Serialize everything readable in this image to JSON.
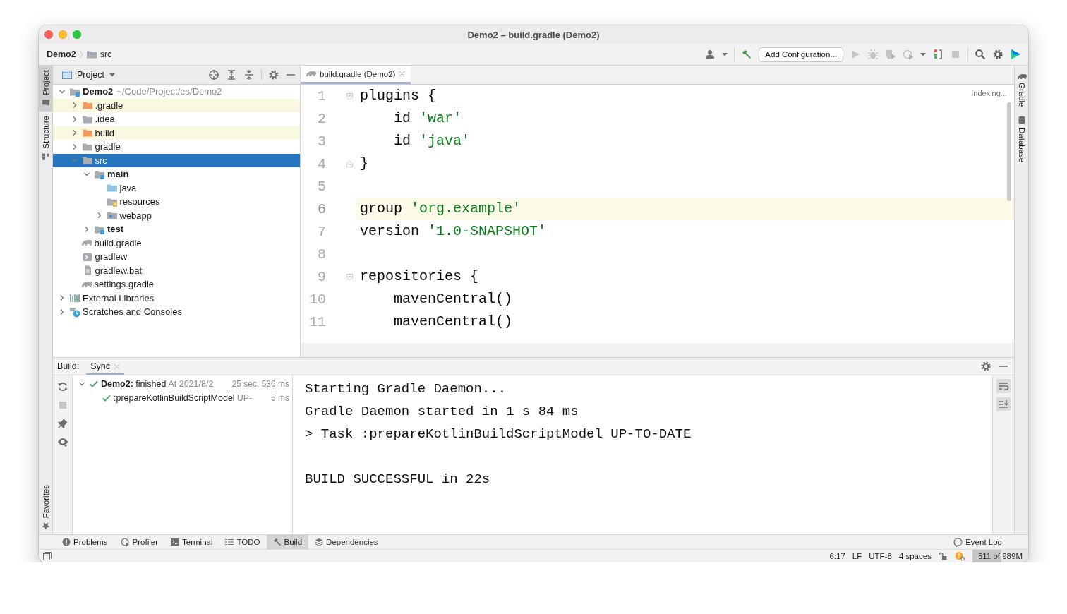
{
  "window": {
    "title": "Demo2 – build.gradle (Demo2)"
  },
  "breadcrumb": [
    {
      "label": "Demo2",
      "kind": "project"
    },
    {
      "label": "src",
      "kind": "folder"
    }
  ],
  "toolbar": {
    "run_config": "Add Configuration..."
  },
  "left_stripe_top": [
    {
      "label": "Project",
      "kind": "folder",
      "selected": true
    },
    {
      "label": "Structure",
      "kind": "structure",
      "selected": false
    }
  ],
  "left_stripe_bottom": [
    {
      "label": "Favorites",
      "kind": "star",
      "selected": false
    }
  ],
  "right_stripe": [
    {
      "label": "Gradle",
      "kind": "elephant"
    },
    {
      "label": "Database",
      "kind": "database"
    }
  ],
  "project_panel": {
    "title": "Project",
    "tree": [
      {
        "label": "Demo2",
        "hint": "~/Code/Project/es/Demo2",
        "kind": "module",
        "bold": true,
        "expanded": true,
        "selected": false,
        "children": [
          {
            "label": ".gradle",
            "kind": "excluded-folder",
            "expanded": false,
            "excluded": true,
            "selected": false
          },
          {
            "label": ".idea",
            "kind": "folder",
            "expanded": false,
            "selected": false
          },
          {
            "label": "build",
            "kind": "excluded-folder",
            "expanded": false,
            "excluded": true,
            "selected": false
          },
          {
            "label": "gradle",
            "kind": "folder",
            "expanded": false,
            "selected": false
          },
          {
            "label": "src",
            "kind": "folder",
            "expanded": true,
            "selected": true,
            "children": [
              {
                "label": "main",
                "kind": "module",
                "bold": true,
                "expanded": true,
                "selected": false,
                "children": [
                  {
                    "label": "java",
                    "kind": "source-root",
                    "selected": false
                  },
                  {
                    "label": "resources",
                    "kind": "resources-root",
                    "selected": false
                  },
                  {
                    "label": "webapp",
                    "kind": "web-folder",
                    "expanded": false,
                    "selected": false
                  }
                ]
              },
              {
                "label": "test",
                "kind": "module",
                "bold": true,
                "expanded": false,
                "selected": false
              }
            ]
          },
          {
            "label": "build.gradle",
            "kind": "gradle-file",
            "selected": false
          },
          {
            "label": "gradlew",
            "kind": "shell-script",
            "selected": false
          },
          {
            "label": "gradlew.bat",
            "kind": "text-file",
            "selected": false
          },
          {
            "label": "settings.gradle",
            "kind": "gradle-file",
            "selected": false
          }
        ]
      },
      {
        "label": "External Libraries",
        "kind": "libraries",
        "expanded": false,
        "selected": false
      },
      {
        "label": "Scratches and Consoles",
        "kind": "scratches",
        "expanded": false,
        "selected": false
      }
    ]
  },
  "editor": {
    "tabs": [
      {
        "label": "build.gradle (Demo2)",
        "selected": true
      }
    ],
    "status": "Indexing...",
    "lines": [
      {
        "number": "1",
        "tokens": [
          {
            "text": "plugins {",
            "kind": "plain"
          }
        ],
        "kind": "block-start",
        "current": false
      },
      {
        "number": "2",
        "tokens": [
          {
            "text": "    id ",
            "kind": "plain"
          },
          {
            "text": "'war'",
            "kind": "string"
          }
        ],
        "kind": "plain",
        "current": false
      },
      {
        "number": "3",
        "tokens": [
          {
            "text": "    id ",
            "kind": "plain"
          },
          {
            "text": "'java'",
            "kind": "string"
          }
        ],
        "kind": "plain",
        "current": false
      },
      {
        "number": "4",
        "tokens": [
          {
            "text": "}",
            "kind": "plain"
          }
        ],
        "kind": "block-end",
        "current": false
      },
      {
        "number": "5",
        "kind": "plain",
        "current": false
      },
      {
        "number": "6",
        "tokens": [
          {
            "text": "group ",
            "kind": "plain"
          },
          {
            "text": "'org.example'",
            "kind": "string"
          }
        ],
        "kind": "plain",
        "current": true
      },
      {
        "number": "7",
        "tokens": [
          {
            "text": "version ",
            "kind": "plain"
          },
          {
            "text": "'1.0-SNAPSHOT'",
            "kind": "string"
          }
        ],
        "kind": "plain",
        "current": false
      },
      {
        "number": "8",
        "kind": "plain",
        "current": false
      },
      {
        "number": "9",
        "tokens": [
          {
            "text": "repositories {",
            "kind": "plain"
          }
        ],
        "kind": "block-start",
        "current": false
      },
      {
        "number": "10",
        "tokens": [
          {
            "text": "    mavenCentral()",
            "kind": "plain"
          }
        ],
        "kind": "plain",
        "current": false
      },
      {
        "number": "11",
        "tokens": [
          {
            "text": "    mavenCentral()",
            "kind": "plain"
          }
        ],
        "kind": "plain",
        "current": false
      }
    ]
  },
  "build_panel": {
    "label": "Build:",
    "tabs": [
      {
        "label": "Sync",
        "selected": true
      }
    ],
    "tree": [
      {
        "kind": "success",
        "text": "**Demo2:** finished",
        "detail": "At 2021/8/2",
        "time": "25 sec, 536 ms",
        "expanded": true,
        "children": [
          {
            "kind": "success",
            "text": ":prepareKotlinBuildScriptModel",
            "detail": "UP-",
            "time": "5 ms"
          }
        ]
      }
    ],
    "console": [
      [
        "Starting Gradle Daemon...",
        "Gradle Daemon started in 1 s 84 ms",
        "> Task :prepareKotlinBuildScriptModel UP-TO-DATE"
      ],
      [
        "BUILD SUCCESSFUL in 22s"
      ]
    ]
  },
  "tool_tabs": [
    {
      "label": "Problems",
      "kind": "problems",
      "selected": false
    },
    {
      "label": "Profiler",
      "kind": "profiler",
      "selected": false
    },
    {
      "label": "Terminal",
      "kind": "terminal",
      "selected": false
    },
    {
      "label": "TODO",
      "kind": "todo",
      "selected": false
    },
    {
      "label": "Build",
      "kind": "build",
      "selected": true
    },
    {
      "label": "Dependencies",
      "kind": "dependencies",
      "selected": false
    }
  ],
  "event_log": "Event Log",
  "status_bar": {
    "position": "6:17",
    "line_separator": "LF",
    "encoding": "UTF-8",
    "indent": "4 spaces",
    "memory": {
      "text": "511 of 989M",
      "level": 0.52
    }
  }
}
